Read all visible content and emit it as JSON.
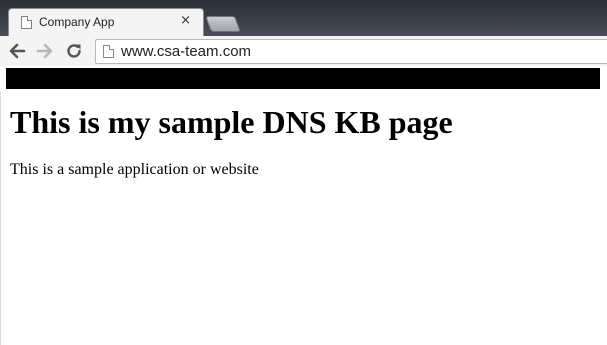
{
  "browser": {
    "tab": {
      "title": "Company App",
      "close_glyph": "×",
      "favicon": "page-icon"
    },
    "new_tab_icon": "new-tab-icon",
    "toolbar": {
      "back_icon": "back-arrow-icon",
      "forward_icon": "forward-arrow-icon",
      "reload_icon": "reload-icon",
      "address": "www.csa-team.com"
    },
    "bookmarks_bar": {
      "redacted": true,
      "color": "#000000"
    }
  },
  "page": {
    "heading": "This is my sample DNS KB page",
    "body_text": "This is a sample application or website"
  },
  "colors": {
    "frame": "#2a2f38",
    "toolbar": "#f4f4f4",
    "content_bg": "#ffffff"
  }
}
